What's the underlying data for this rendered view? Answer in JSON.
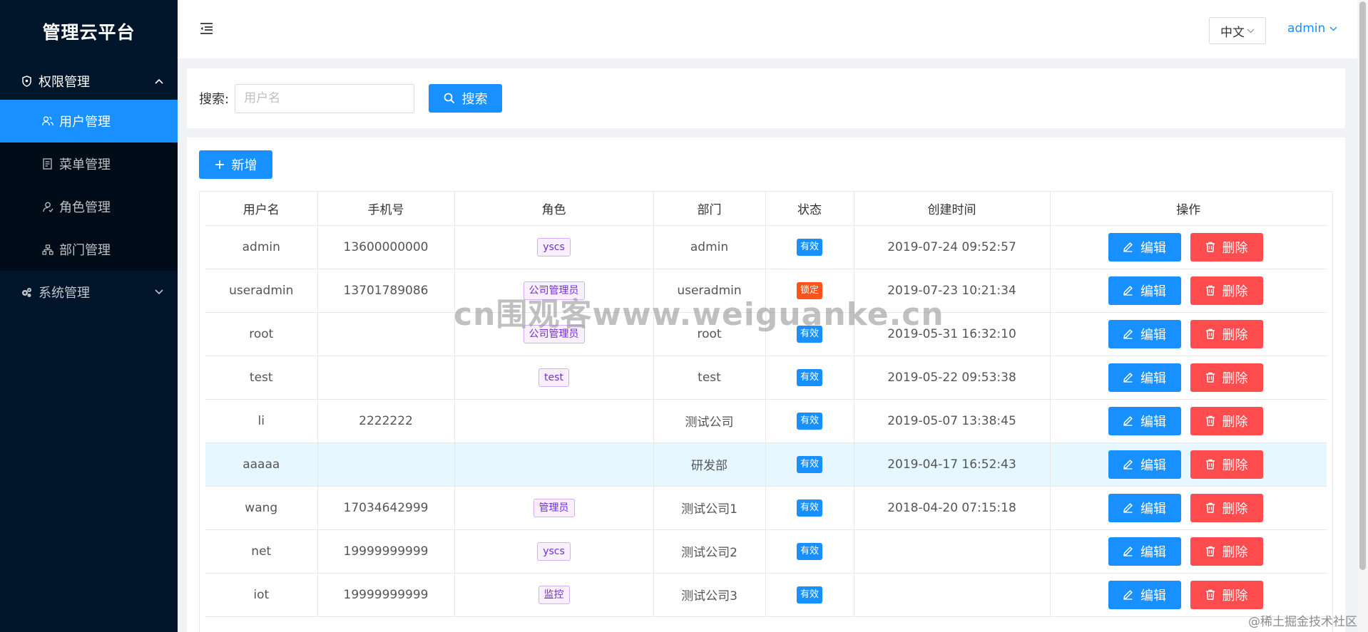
{
  "sidebar": {
    "logo": "管理云平台",
    "groups": [
      {
        "label": "权限管理",
        "icon": "shield-icon",
        "expanded": true,
        "items": [
          {
            "label": "用户管理",
            "icon": "users-icon",
            "active": true
          },
          {
            "label": "菜单管理",
            "icon": "document-icon",
            "active": false
          },
          {
            "label": "角色管理",
            "icon": "user-icon",
            "active": false
          },
          {
            "label": "部门管理",
            "icon": "org-chart-icon",
            "active": false
          }
        ]
      },
      {
        "label": "系统管理",
        "icon": "gears-icon",
        "expanded": false
      }
    ]
  },
  "header": {
    "language": "中文",
    "user": "admin"
  },
  "search": {
    "label": "搜索:",
    "placeholder": "用户名",
    "button": "搜索"
  },
  "toolbar": {
    "add_label": "新增"
  },
  "table": {
    "columns": [
      "用户名",
      "手机号",
      "角色",
      "部门",
      "状态",
      "创建时间",
      "操作"
    ],
    "rows": [
      {
        "username": "admin",
        "phone": "13600000000",
        "roles": [
          "yscs"
        ],
        "dept": "admin",
        "status": "有效",
        "created": "2019-07-24 09:52:57"
      },
      {
        "username": "useradmin",
        "phone": "13701789086",
        "roles": [
          "公司管理员"
        ],
        "dept": "useradmin",
        "status": "锁定",
        "created": "2019-07-23 10:21:34"
      },
      {
        "username": "root",
        "phone": "",
        "roles": [
          "公司管理员"
        ],
        "dept": "root",
        "status": "有效",
        "created": "2019-05-31 16:32:10"
      },
      {
        "username": "test",
        "phone": "",
        "roles": [
          "test"
        ],
        "dept": "test",
        "status": "有效",
        "created": "2019-05-22 09:53:38"
      },
      {
        "username": "li",
        "phone": "2222222",
        "roles": [],
        "dept": "测试公司",
        "status": "有效",
        "created": "2019-05-07 13:38:45"
      },
      {
        "username": "aaaaa",
        "phone": "",
        "roles": [],
        "dept": "研发部",
        "status": "有效",
        "created": "2019-04-17 16:52:43"
      },
      {
        "username": "wang",
        "phone": "17034642999",
        "roles": [
          "管理员"
        ],
        "dept": "测试公司1",
        "status": "有效",
        "created": "2018-04-20 07:15:18"
      },
      {
        "username": "net",
        "phone": "19999999999",
        "roles": [
          "yscs"
        ],
        "dept": "测试公司2",
        "status": "有效",
        "created": ""
      },
      {
        "username": "iot",
        "phone": "19999999999",
        "roles": [
          "监控"
        ],
        "dept": "测试公司3",
        "status": "有效",
        "created": ""
      }
    ],
    "highlight_row": 5,
    "edit_label": "编辑",
    "delete_label": "删除"
  },
  "status_colors": {
    "有效": "#1890ff",
    "锁定": "#fa541c"
  },
  "watermarks": {
    "center": "cn围观客www.weiguanke.cn",
    "corner": "@稀土掘金技术社区"
  }
}
